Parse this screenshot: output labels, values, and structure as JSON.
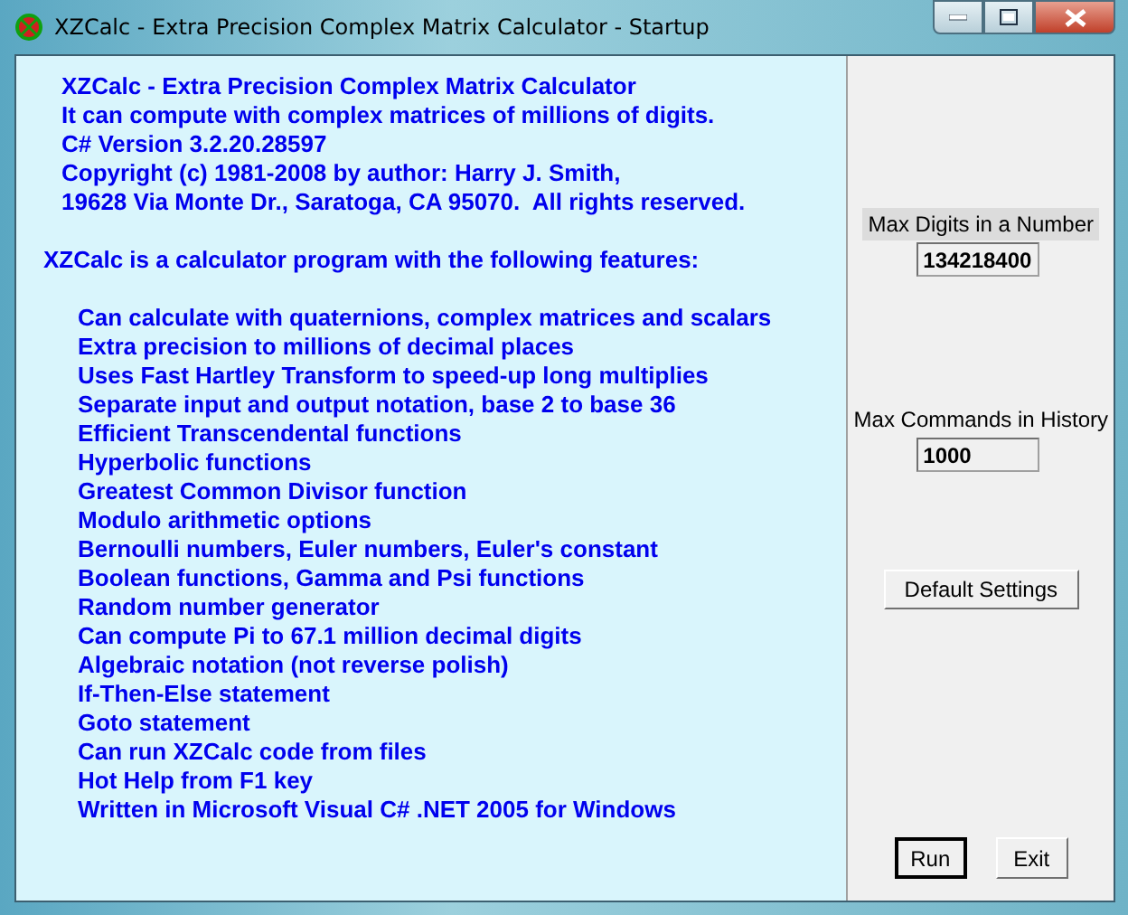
{
  "window": {
    "title": "XZCalc - Extra Precision Complex Matrix Calculator - Startup"
  },
  "intro": [
    "XZCalc - Extra Precision Complex Matrix Calculator",
    "It can compute with complex matrices of millions of digits.",
    "C# Version 3.2.20.28597",
    "Copyright (c) 1981-2008 by author: Harry J. Smith,",
    "19628 Via Monte Dr., Saratoga, CA 95070.  All rights reserved."
  ],
  "features_heading": "XZCalc is a calculator program with the following features:",
  "features": [
    "Can calculate with quaternions, complex matrices and scalars",
    "Extra precision to millions of decimal places",
    "Uses Fast Hartley Transform to speed-up long multiplies",
    "Separate input and output notation, base 2 to base 36",
    "Efficient Transcendental functions",
    "Hyperbolic functions",
    "Greatest Common Divisor function",
    "Modulo arithmetic options",
    "Bernoulli numbers, Euler numbers, Euler's constant",
    "Boolean functions, Gamma and Psi functions",
    "Random number generator",
    "Can compute Pi to 67.1 million decimal digits",
    "Algebraic notation (not reverse polish)",
    "If-Then-Else statement",
    "Goto statement",
    "Can run XZCalc code from files",
    "Hot Help from F1 key",
    "Written in Microsoft Visual C# .NET 2005 for Windows"
  ],
  "settings": [
    {
      "label": "Max Digits in a Number",
      "value": "134218400",
      "selected": true
    },
    {
      "label": "Max Commands in History",
      "value": "1000",
      "selected": false
    }
  ],
  "default_settings_button": "Default Settings",
  "buttons": [
    {
      "label": "Run",
      "default": true
    },
    {
      "label": "Exit",
      "default": false
    }
  ]
}
